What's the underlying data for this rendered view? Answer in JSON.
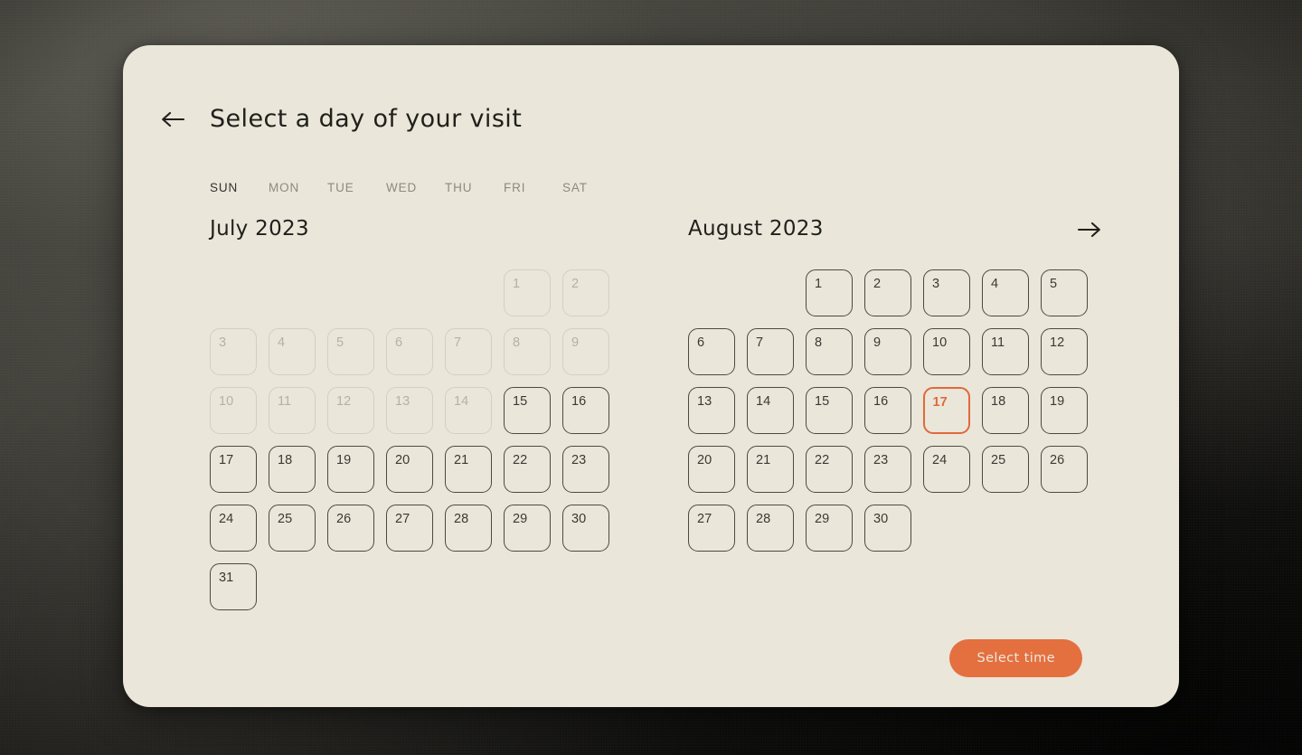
{
  "background": {
    "base_color": "#3c3b35",
    "dark_color": "#1a1914"
  },
  "card": {
    "background_color": "#eae6da"
  },
  "header": {
    "back_icon": "arrow-left-icon",
    "title": "Select a day of your visit"
  },
  "weekdays": [
    {
      "label": "SUN",
      "active": true
    },
    {
      "label": "MON",
      "active": false
    },
    {
      "label": "TUE",
      "active": false
    },
    {
      "label": "WED",
      "active": false
    },
    {
      "label": "THU",
      "active": false
    },
    {
      "label": "FRI",
      "active": false
    },
    {
      "label": "SAT",
      "active": false
    }
  ],
  "next_icon": "arrow-right-icon",
  "colors": {
    "accent": "#e4703f",
    "selected_border": "#e2683c",
    "enabled_text": "#3b3933",
    "disabled_text": "#b6b1a4",
    "enabled_border": "#4c4941",
    "disabled_border": "#d4cfc0"
  },
  "months": [
    {
      "title": "July 2023",
      "leading_blanks": 5,
      "days": [
        {
          "n": "1",
          "state": "disabled"
        },
        {
          "n": "2",
          "state": "disabled"
        },
        {
          "n": "3",
          "state": "disabled"
        },
        {
          "n": "4",
          "state": "disabled"
        },
        {
          "n": "5",
          "state": "disabled"
        },
        {
          "n": "6",
          "state": "disabled"
        },
        {
          "n": "7",
          "state": "disabled"
        },
        {
          "n": "8",
          "state": "disabled"
        },
        {
          "n": "9",
          "state": "disabled"
        },
        {
          "n": "10",
          "state": "disabled"
        },
        {
          "n": "11",
          "state": "disabled"
        },
        {
          "n": "12",
          "state": "disabled"
        },
        {
          "n": "13",
          "state": "disabled"
        },
        {
          "n": "14",
          "state": "disabled"
        },
        {
          "n": "15",
          "state": "enabled"
        },
        {
          "n": "16",
          "state": "enabled"
        },
        {
          "n": "17",
          "state": "enabled"
        },
        {
          "n": "18",
          "state": "enabled"
        },
        {
          "n": "19",
          "state": "enabled"
        },
        {
          "n": "20",
          "state": "enabled"
        },
        {
          "n": "21",
          "state": "enabled"
        },
        {
          "n": "22",
          "state": "enabled"
        },
        {
          "n": "23",
          "state": "enabled"
        },
        {
          "n": "24",
          "state": "enabled"
        },
        {
          "n": "25",
          "state": "enabled"
        },
        {
          "n": "26",
          "state": "enabled"
        },
        {
          "n": "27",
          "state": "enabled"
        },
        {
          "n": "28",
          "state": "enabled"
        },
        {
          "n": "29",
          "state": "enabled"
        },
        {
          "n": "30",
          "state": "enabled"
        },
        {
          "n": "31",
          "state": "enabled"
        }
      ]
    },
    {
      "title": "August 2023",
      "leading_blanks": 2,
      "days": [
        {
          "n": "1",
          "state": "enabled"
        },
        {
          "n": "2",
          "state": "enabled"
        },
        {
          "n": "3",
          "state": "enabled"
        },
        {
          "n": "4",
          "state": "enabled"
        },
        {
          "n": "5",
          "state": "enabled"
        },
        {
          "n": "6",
          "state": "enabled"
        },
        {
          "n": "7",
          "state": "enabled"
        },
        {
          "n": "8",
          "state": "enabled"
        },
        {
          "n": "9",
          "state": "enabled"
        },
        {
          "n": "10",
          "state": "enabled"
        },
        {
          "n": "11",
          "state": "enabled"
        },
        {
          "n": "12",
          "state": "enabled"
        },
        {
          "n": "13",
          "state": "enabled"
        },
        {
          "n": "14",
          "state": "enabled"
        },
        {
          "n": "15",
          "state": "enabled"
        },
        {
          "n": "16",
          "state": "enabled"
        },
        {
          "n": "17",
          "state": "selected"
        },
        {
          "n": "18",
          "state": "enabled"
        },
        {
          "n": "19",
          "state": "enabled"
        },
        {
          "n": "20",
          "state": "enabled"
        },
        {
          "n": "21",
          "state": "enabled"
        },
        {
          "n": "22",
          "state": "enabled"
        },
        {
          "n": "23",
          "state": "enabled"
        },
        {
          "n": "24",
          "state": "enabled"
        },
        {
          "n": "25",
          "state": "enabled"
        },
        {
          "n": "26",
          "state": "enabled"
        },
        {
          "n": "27",
          "state": "enabled"
        },
        {
          "n": "28",
          "state": "enabled"
        },
        {
          "n": "29",
          "state": "enabled"
        },
        {
          "n": "30",
          "state": "enabled"
        }
      ]
    }
  ],
  "footer": {
    "select_time_label": "Select time"
  }
}
